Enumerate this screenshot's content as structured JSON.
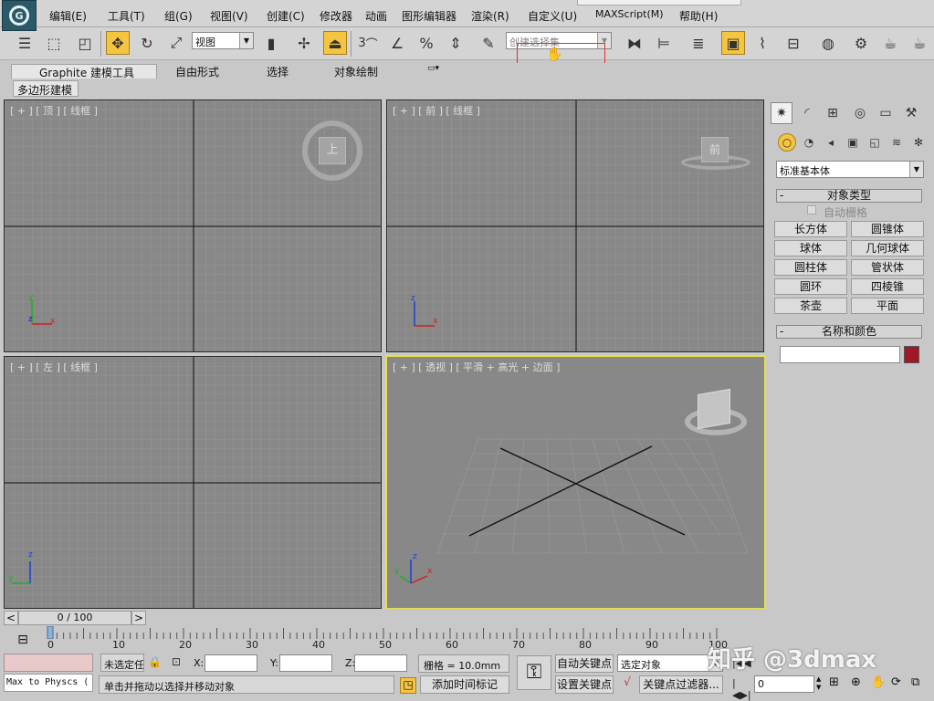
{
  "menu": {
    "items": [
      "编辑(E)",
      "工具(T)",
      "组(G)",
      "视图(V)",
      "创建(C)",
      "修改器",
      "动画",
      "图形编辑器",
      "渲染(R)",
      "自定义(U)",
      "MAXScript(M)",
      "帮助(H)"
    ]
  },
  "toolbar": {
    "view_combo": "视图",
    "snap_label": "3",
    "selection_set_placeholder": "创建选择集"
  },
  "ribbon": {
    "tabs": [
      "Graphite 建模工具",
      "自由形式",
      "选择",
      "对象绘制"
    ],
    "subtab": "多边形建模"
  },
  "viewports": {
    "top": {
      "label": "[ + ] [ 顶 ] [ 线框 ]",
      "cube_label": "上"
    },
    "front": {
      "label": "[ + ] [ 前 ] [ 线框 ]",
      "cube_label": "前"
    },
    "left": {
      "label": "[ + ] [ 左 ] [ 线框 ]"
    },
    "persp": {
      "label": "[ + ] [ 透视 ] [ 平滑 + 高光 + 边面 ]"
    },
    "axes": {
      "x": "x",
      "y": "y",
      "z": "z"
    }
  },
  "command_panel": {
    "category_combo": "标准基本体",
    "object_type_title": "对象类型",
    "auto_grid_label": "自动栅格",
    "primitives": [
      "长方体",
      "圆锥体",
      "球体",
      "几何球体",
      "圆柱体",
      "管状体",
      "圆环",
      "四棱锥",
      "茶壶",
      "平面"
    ],
    "name_color_title": "名称和颜色",
    "object_color": "#a01828"
  },
  "timeline": {
    "frame_display": "0 / 100",
    "prev_arrow": "<",
    "next_arrow": ">",
    "ticks": [
      "0",
      "10",
      "20",
      "30",
      "40",
      "50",
      "60",
      "70",
      "80",
      "90",
      "100"
    ]
  },
  "status": {
    "script_listener": "Max to Physcs (",
    "selection_status": "未选定任",
    "x_label": "X:",
    "y_label": "Y:",
    "z_label": "Z:",
    "grid": "栅格 = 10.0mm",
    "auto_key": "自动关键点",
    "selected_object": "选定对象",
    "set_key": "设置关键点",
    "key_filters": "关键点过滤器...",
    "prompt": "单击并拖动以选择并移动对象",
    "add_time_tag": "添加时间标记",
    "current_frame": "0"
  },
  "watermark": "知乎 @3dmax"
}
